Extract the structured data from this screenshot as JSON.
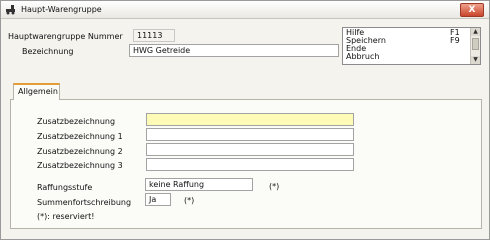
{
  "window": {
    "title": "Haupt-Warengruppe",
    "close_glyph": "X"
  },
  "header": {
    "nummer_label": "Hauptwarengruppe Nummer",
    "nummer_value": "11113",
    "bezeichnung_label": "Bezeichnung",
    "bezeichnung_value": "HWG Getreide"
  },
  "shortcuts": [
    {
      "label": "Hilfe",
      "key": "F1"
    },
    {
      "label": "Speichern",
      "key": "F9"
    },
    {
      "label": "Ende",
      "key": ""
    },
    {
      "label": "Abbruch",
      "key": ""
    }
  ],
  "tabs": [
    {
      "label": "Allgemein"
    }
  ],
  "form": {
    "zusatz_label": "Zusatzbezeichnung",
    "zusatz_value": "",
    "zusatz1_label": "Zusatzbezeichnung 1",
    "zusatz1_value": "",
    "zusatz2_label": "Zusatzbezeichnung 2",
    "zusatz2_value": "",
    "zusatz3_label": "Zusatzbezeichnung 3",
    "zusatz3_value": "",
    "raffung_label": "Raffungsstufe",
    "raffung_value": "keine Raffung",
    "raffung_note": "(*)",
    "summen_label": "Summenfortschreibung",
    "summen_value": "Ja",
    "summen_note": "(*)",
    "reserved_note": "(*): reserviert!"
  },
  "colors": {
    "focus_field": "#fefbb6",
    "tab_accent": "#e39e3a",
    "close_button": "#c8452c"
  }
}
